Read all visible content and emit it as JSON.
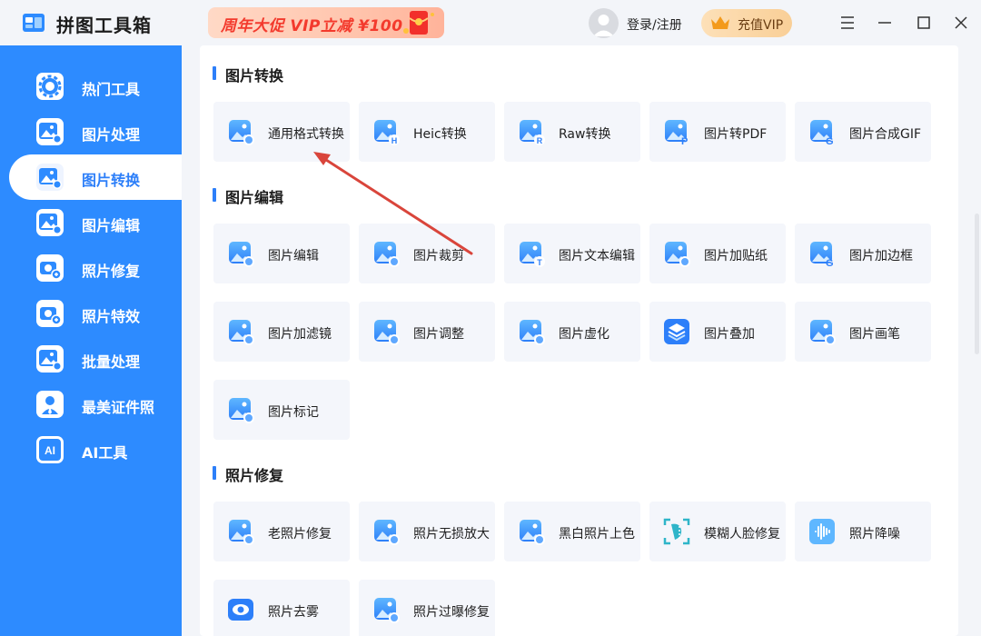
{
  "app": {
    "title": "拼图工具箱"
  },
  "header": {
    "promo": "周年大促 VIP立减 ¥100",
    "login": "登录/注册",
    "vip": "充值VIP"
  },
  "sidebar": {
    "items": [
      {
        "label": "热门工具",
        "icon": "gear-icon",
        "active": false
      },
      {
        "label": "图片处理",
        "icon": "image-clock-icon",
        "active": false
      },
      {
        "label": "图片转换",
        "icon": "image-convert-icon",
        "active": true
      },
      {
        "label": "图片编辑",
        "icon": "image-edit-icon",
        "active": false
      },
      {
        "label": "照片修复",
        "icon": "camera-plus-icon",
        "active": false
      },
      {
        "label": "照片特效",
        "icon": "camera-wand-icon",
        "active": false
      },
      {
        "label": "批量处理",
        "icon": "image-batch-icon",
        "active": false
      },
      {
        "label": "最美证件照",
        "icon": "id-photo-icon",
        "active": false
      },
      {
        "label": "AI工具",
        "icon": "ai-icon",
        "active": false
      }
    ]
  },
  "sections": [
    {
      "title": "图片转换",
      "tools": [
        {
          "label": "通用格式转换",
          "icon": "format-convert-icon"
        },
        {
          "label": "Heic转换",
          "icon": "heic-icon"
        },
        {
          "label": "Raw转换",
          "icon": "raw-icon"
        },
        {
          "label": "图片转PDF",
          "icon": "pdf-icon"
        },
        {
          "label": "图片合成GIF",
          "icon": "gif-icon"
        }
      ]
    },
    {
      "title": "图片编辑",
      "tools": [
        {
          "label": "图片编辑",
          "icon": "image-edit-icon"
        },
        {
          "label": "图片裁剪",
          "icon": "crop-icon"
        },
        {
          "label": "图片文本编辑",
          "icon": "text-edit-icon"
        },
        {
          "label": "图片加贴纸",
          "icon": "sticker-icon"
        },
        {
          "label": "图片加边框",
          "icon": "border-icon"
        },
        {
          "label": "图片加滤镜",
          "icon": "filter-icon"
        },
        {
          "label": "图片调整",
          "icon": "adjust-icon"
        },
        {
          "label": "图片虚化",
          "icon": "blur-icon"
        },
        {
          "label": "图片叠加",
          "icon": "layers-icon"
        },
        {
          "label": "图片画笔",
          "icon": "brush-icon"
        },
        {
          "label": "图片标记",
          "icon": "marker-icon"
        }
      ]
    },
    {
      "title": "照片修复",
      "tools": [
        {
          "label": "老照片修复",
          "icon": "old-photo-icon"
        },
        {
          "label": "照片无损放大",
          "icon": "upscale-icon"
        },
        {
          "label": "黑白照片上色",
          "icon": "colorize-icon"
        },
        {
          "label": "模糊人脸修复",
          "icon": "face-repair-icon"
        },
        {
          "label": "照片降噪",
          "icon": "denoise-icon"
        },
        {
          "label": "照片去雾",
          "icon": "dehaze-icon"
        },
        {
          "label": "照片过曝修复",
          "icon": "exposure-icon"
        }
      ]
    }
  ],
  "colors": {
    "accent": "#2d8bff",
    "annotation_arrow": "#d9453b"
  }
}
